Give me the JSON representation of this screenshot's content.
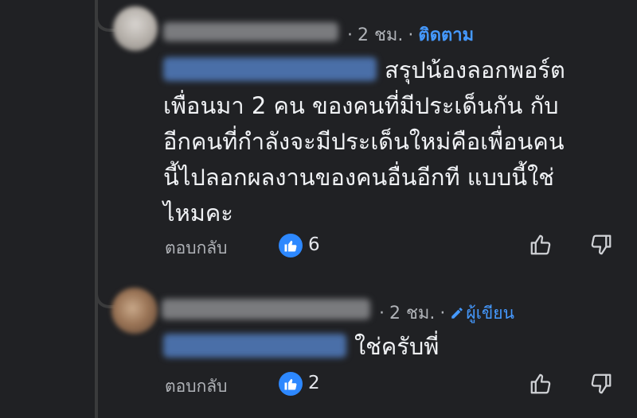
{
  "comments": [
    {
      "author": "",
      "time": "2 ชม.",
      "follow_label": "ติดตาม",
      "mention": "",
      "text_lines": [
        "สรุปน้องลอกพอร์ต",
        "เพื่อนมา 2 คน ของคนที่มีประเด็นกัน กับ",
        "อีกคนที่กำลังจะมีประเด็นใหม่คือเพื่อนคน",
        "นี้ไปลอกผลงานของคนอื่นอีกที แบบนี้ใช่",
        "ไหมคะ"
      ],
      "reply_label": "ตอบกลับ",
      "like_count": "6",
      "like_icon": "thumbs-up-icon"
    },
    {
      "author": "",
      "time": "2 ชม.",
      "author_badge": "ผู้เขียน",
      "author_badge_icon": "pencil-icon",
      "mention": "",
      "text_lines": [
        "ใช่ครับพี่"
      ],
      "reply_label": "ตอบกลับ",
      "like_count": "2",
      "like_icon": "thumbs-up-icon"
    }
  ],
  "colors": {
    "background": "#202124",
    "link_blue": "#4599ff",
    "like_badge": "#2d88ff",
    "muted_text": "#b0b3b8",
    "body_text": "#f0f2f5"
  }
}
